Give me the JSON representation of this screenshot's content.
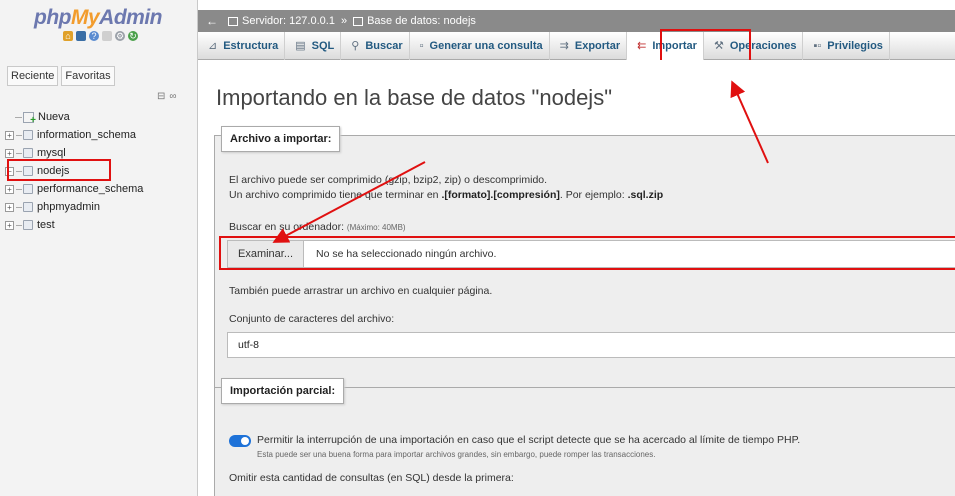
{
  "logo": {
    "part1": "php",
    "part2": "My",
    "part3": "Admin"
  },
  "sidebar": {
    "tabs": [
      "Reciente",
      "Favoritas"
    ],
    "new_label": "Nueva",
    "databases": [
      "information_schema",
      "mysql",
      "nodejs",
      "performance_schema",
      "phpmyadmin",
      "test"
    ]
  },
  "breadcrumb": {
    "server": "Servidor: 127.0.0.1",
    "separator": "»",
    "database": "Base de datos: nodejs"
  },
  "tabs": [
    {
      "label": "Estructura",
      "icon": "structure-icon"
    },
    {
      "label": "SQL",
      "icon": "sql-icon"
    },
    {
      "label": "Buscar",
      "icon": "search-icon"
    },
    {
      "label": "Generar una consulta",
      "icon": "query-icon"
    },
    {
      "label": "Exportar",
      "icon": "export-icon"
    },
    {
      "label": "Importar",
      "icon": "import-icon"
    },
    {
      "label": "Operaciones",
      "icon": "wrench-icon"
    },
    {
      "label": "Privilegios",
      "icon": "privileges-icon"
    }
  ],
  "page_title": "Importando en la base de datos \"nodejs\"",
  "file_section": {
    "legend": "Archivo a importar:",
    "line1": "El archivo puede ser comprimido (gzip, bzip2, zip) o descomprimido.",
    "line2_prefix": "Un archivo comprimido tiene que terminar en ",
    "line2_format": ".[formato].[compresión]",
    "line2_mid": ". Por ejemplo: ",
    "line2_example": ".sql.zip",
    "browse_label": "Buscar en su ordenador:",
    "max_size": "(Máximo: 40MB)",
    "browse_button": "Examinar...",
    "file_status": "No se ha seleccionado ningún archivo.",
    "drag_hint": "También puede arrastrar un archivo en cualquier página.",
    "charset_label": "Conjunto de caracteres del archivo:",
    "charset_value": "utf-8"
  },
  "partial_section": {
    "legend": "Importación parcial:",
    "allow_interrupt": "Permitir la interrupción de una importación en caso que el script detecte que se ha acercado al límite de tiempo PHP.",
    "interrupt_note": "Esta puede ser una buena forma para importar archivos grandes, sin embargo, puede romper las transacciones.",
    "skip_label": "Omitir esta cantidad de consultas (en SQL) desde la primera:"
  },
  "colors": {
    "highlight": "#e01010",
    "link": "#235a81",
    "toggle": "#1e72d8"
  }
}
